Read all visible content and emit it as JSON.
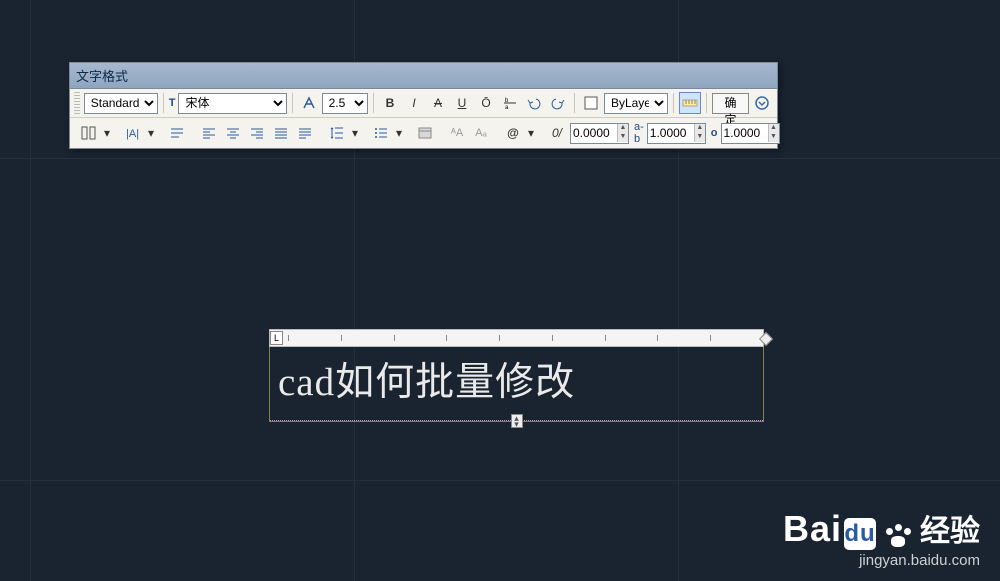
{
  "panel": {
    "title": "文字格式",
    "row1": {
      "style": "Standard",
      "font_prefix": "T",
      "font": "宋体",
      "annotative_icon": "annotative",
      "height": "2.5",
      "bold": "B",
      "italic": "I",
      "strike": "A",
      "underline": "U",
      "overline": "Ō",
      "stack": "stack",
      "bylayer": "ByLayer",
      "ruler_toggle": "ruler",
      "ok": "确定",
      "more": "▾"
    },
    "row2": {
      "columns_icon": "columns",
      "mtext_icon": "mtext",
      "para_icon": "paragraph",
      "align": [
        "left",
        "center",
        "right",
        "justify",
        "distribute"
      ],
      "linespace_icon": "line-spacing",
      "numbering_icon": "numbering",
      "field_icon": "insert-field",
      "upper": "A",
      "lower": "a",
      "symbol": "@",
      "oblique": "0/",
      "oblique_val": "0.0000",
      "tracking_label": "a-b",
      "tracking_val": "1.0000",
      "width_label": "o",
      "width_val": "1.0000"
    }
  },
  "editor": {
    "ruler_corner": "L",
    "text": "cad如何批量修改",
    "drag_handle": "◂▸"
  },
  "watermark": {
    "brand": "Bai",
    "du": "du",
    "jy": "经验",
    "url": "jingyan.baidu.com"
  }
}
